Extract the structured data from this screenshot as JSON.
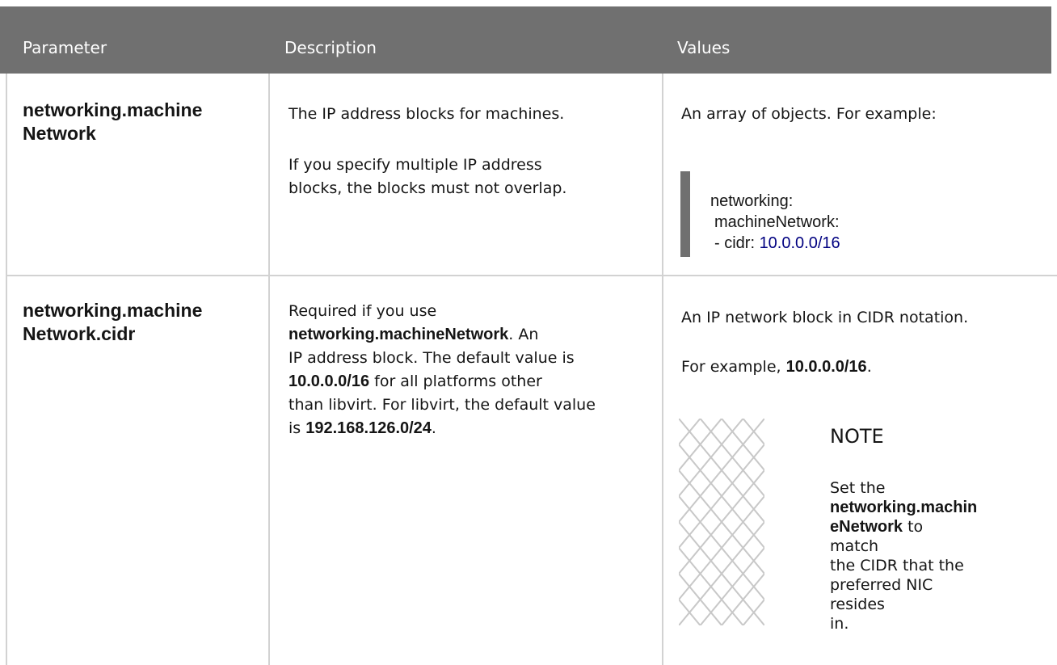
{
  "table": {
    "headers": [
      "Parameter",
      "Description",
      "Values"
    ],
    "rows": [
      {
        "parameter_line1": "networking.machine",
        "parameter_line2": "Network",
        "description": {
          "p1": "The IP address blocks for machines.",
          "p2_line1": "If you specify multiple IP address",
          "p2_line2": "blocks, the blocks must not overlap."
        },
        "values": {
          "intro": "An array of objects. For example:",
          "code_line1": "networking:",
          "code_line2": "machineNetwork:",
          "code_line3_key": "- cidr: ",
          "code_line3_value": "10.0.0.0/16"
        }
      },
      {
        "parameter_line1": "networking.machine",
        "parameter_line2": "Network.cidr",
        "description": {
          "l1": "Required if you use",
          "l2_bold": "networking.machineNetwork",
          "l2_rest": ". An",
          "l3": "IP address block. The default value is",
          "l4_bold": "10.0.0.0/16",
          "l4_rest": " for all platforms other",
          "l5": "than libvirt. For libvirt, the default value",
          "l6_pre": "is ",
          "l6_bold": "192.168.126.0/24",
          "l6_rest": "."
        },
        "values": {
          "line1": "An IP network block in CIDR notation.",
          "line2_pre": "For example, ",
          "line2_bold": "10.0.0.0/16",
          "line2_rest": ".",
          "note_title": "NOTE",
          "note_l1": "Set the",
          "note_l2_bold": "networking.machin",
          "note_l3_bold": "eNetwork",
          "note_l3_rest": " to match",
          "note_l4": "the CIDR that the",
          "note_l5": "preferred NIC resides",
          "note_l6": "in."
        }
      }
    ]
  }
}
